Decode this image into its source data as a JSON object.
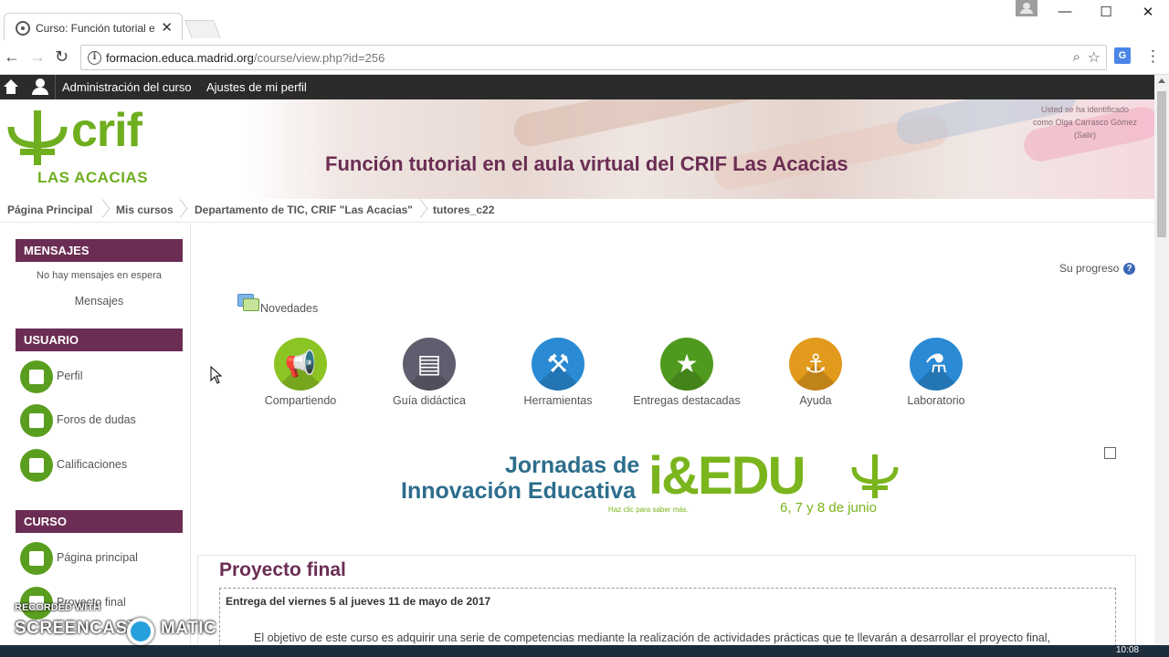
{
  "browser": {
    "tab_title": "Curso: Función tutorial e",
    "url_host": "formacion.educa.madrid.org",
    "url_path": "/course/view.php?id=256",
    "close_glyph": "✕",
    "minimize_glyph": "—",
    "maximize_glyph": "☐",
    "win_close_glyph": "✕",
    "back_glyph": "←",
    "forward_glyph": "→",
    "reload_glyph": "↻",
    "info_glyph": "i",
    "zoom_glyph": "⌕",
    "star_glyph": "☆",
    "translate_glyph": "G",
    "menu_glyph": "⋮"
  },
  "topnav": {
    "admin_link": "Administración del curso",
    "profile_settings_link": "Ajustes de mi perfil"
  },
  "header": {
    "logo_text": "crif",
    "logo_sub": "LAS ACACIAS",
    "course_title": "Función tutorial en el aula virtual del CRIF Las Acacias",
    "login_line1": "Usted se ha identificado",
    "login_line2": "como Olga Carrasco Gómez",
    "logout": "(Salir)"
  },
  "breadcrumb": [
    "Página Principal",
    "Mis cursos",
    "Departamento de TIC, CRIF \"Las Acacias\"",
    "tutores_c22"
  ],
  "sidebar": {
    "messages": {
      "title": "MENSAJES",
      "empty_text": "No hay mensajes en espera",
      "link": "Mensajes"
    },
    "user": {
      "title": "USUARIO",
      "items": [
        {
          "label": "Perfil",
          "icon": "profile-icon"
        },
        {
          "label": "Foros de dudas",
          "icon": "group-icon"
        },
        {
          "label": "Calificaciones",
          "icon": "grades-icon"
        }
      ]
    },
    "course": {
      "title": "CURSO",
      "items": [
        {
          "label": "Página principal",
          "icon": "home-icon"
        },
        {
          "label": "Proyecto final",
          "icon": "project-icon"
        }
      ]
    }
  },
  "main": {
    "progress_label": "Su progreso",
    "help_glyph": "?",
    "news_label": "Novedades",
    "tiles": [
      {
        "label": "Compartiendo",
        "color": "#8cc424",
        "glyph": "📢",
        "icon": "megaphone-icon"
      },
      {
        "label": "Guía didáctica",
        "color": "#5e5e6e",
        "glyph": "▤",
        "icon": "notebook-icon"
      },
      {
        "label": "Herramientas",
        "color": "#2a8ad4",
        "glyph": "⚒",
        "icon": "tools-icon"
      },
      {
        "label": "Entregas destacadas",
        "color": "#4f9a1e",
        "glyph": "★",
        "icon": "star-icon"
      },
      {
        "label": "Ayuda",
        "color": "#e29a1d",
        "glyph": "⚓",
        "icon": "help-person-icon"
      },
      {
        "label": "Laboratorio",
        "color": "#2a8ad4",
        "glyph": "⚗",
        "icon": "flask-icon"
      }
    ],
    "banner": {
      "line1": "Jornadas de",
      "line2": "Innovación Educativa",
      "brand": "i&EDU",
      "click_text": "Haz clic para saber más.",
      "dates": "6, 7 y 8 de junio"
    },
    "section": {
      "title": "Proyecto final",
      "date": "Entrega del viernes 5 al jueves 11 de mayo de 2017",
      "text": "El objetivo de este curso es adquirir una serie de competencias mediante la realización de actividades prácticas que te llevarán a desarrollar el proyecto final,"
    }
  },
  "taskbar": {
    "clock": "10:08"
  },
  "watermark": {
    "recorded": "RECORDED WITH",
    "brand_left": "SCREENCAST",
    "brand_right": "MATIC"
  },
  "colors": {
    "brand_purple": "#6b2d53",
    "brand_green": "#6fae1e",
    "topnav_bg": "#2b2b2b"
  }
}
